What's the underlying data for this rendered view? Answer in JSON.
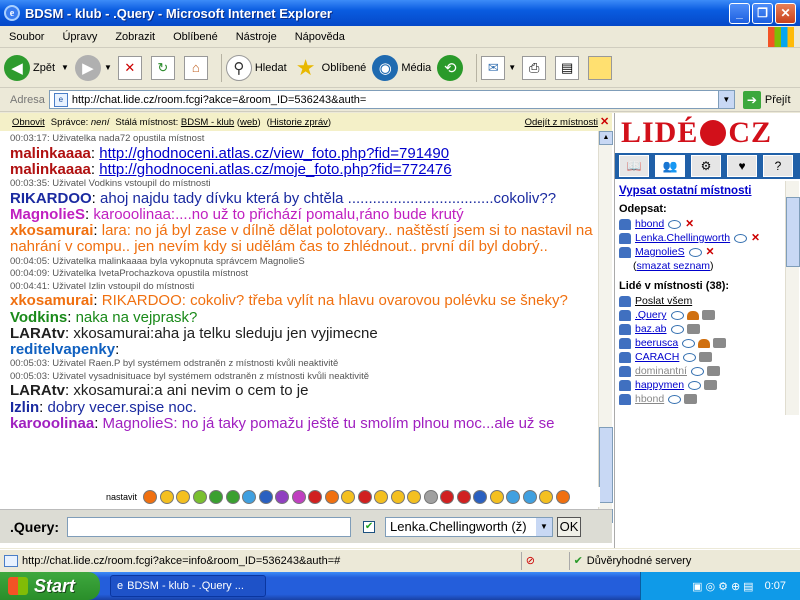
{
  "window": {
    "title": "BDSM - klub - .Query - Microsoft Internet Explorer"
  },
  "menu": [
    "Soubor",
    "Úpravy",
    "Zobrazit",
    "Oblíbené",
    "Nástroje",
    "Nápověda"
  ],
  "toolbar": {
    "back": "Zpět",
    "search": "Hledat",
    "favorites": "Oblíbené",
    "media": "Média"
  },
  "address": {
    "label": "Adresa",
    "url": "http://chat.lide.cz/room.fcgi?akce=&room_ID=536243&auth=",
    "go": "Přejít"
  },
  "topbar": {
    "refresh": "Obnovit",
    "admin_label": "Správce:",
    "admin_value": "není",
    "room_label": "Stálá místnost:",
    "room_name": "BDSM - klub",
    "web": "web",
    "history": "Historie zpráv",
    "leave": "Odejít z místnosti"
  },
  "messages": [
    {
      "type": "sys",
      "text": "00:03:17: Uživatelka nada72 opustila místnost"
    },
    {
      "type": "msg",
      "nick": "malinkaaaa",
      "nick_color": "#b01010",
      "link": "http://ghodnoceni.atlas.cz/view_foto.php?fid=791490"
    },
    {
      "type": "msg",
      "nick": "malinkaaaa",
      "nick_color": "#b01010",
      "link": "http://ghodnoceni.atlas.cz/moje_foto.php?fid=772476"
    },
    {
      "type": "sys",
      "text": "00:03:35: Uživatel Vodkins vstoupil do místnosti"
    },
    {
      "type": "msg",
      "nick": "RIKARDOO",
      "nick_color": "#1a2aa0",
      "text": "ahoj najdu tady dívku která by chtěla ...................................cokoliv??",
      "color": "#1a2aa0"
    },
    {
      "type": "msg",
      "nick": "MagnolieS",
      "nick_color": "#c020c0",
      "text": "karooolinaa:....no už to přichází pomalu,ráno bude krutý",
      "color": "#c020c0"
    },
    {
      "type": "msg",
      "nick": "xkosamurai",
      "nick_color": "#f07010",
      "text": "lara: no já byl zase v dílně dělat polotovary.. naštěstí jsem si to nastavil na nahrání v compu.. jen nevím kdy si udělám čas to zhlédnout.. první díl byl dobrý..",
      "color": "#f07010",
      "wrap": true
    },
    {
      "type": "sys",
      "text": "00:04:05: Uživatelka malinkaaaa byla vykopnuta správcem MagnolieS"
    },
    {
      "type": "sys",
      "text": "00:04:09: Uživatelka IvetaProchazkova opustila místnost"
    },
    {
      "type": "sys",
      "text": "00:04:41: Uživatel Izlin vstoupil do místnosti"
    },
    {
      "type": "msg",
      "nick": "xkosamurai",
      "nick_color": "#f07010",
      "text": "RIKARDOO: cokoliv? třeba vylít na hlavu ovarovou polévku se šneky?",
      "color": "#f07010"
    },
    {
      "type": "msg",
      "nick": "Vodkins",
      "nick_color": "#1a8a1a",
      "text": "naka na vejprask?",
      "color": "#1a8a1a"
    },
    {
      "type": "msg",
      "nick": "LARAtv",
      "nick_color": "#202020",
      "text": "xkosamurai:aha ja telku sleduju jen vyjimecne",
      "color": "#202020"
    },
    {
      "type": "msg",
      "nick": "reditelvapenky",
      "nick_color": "#1060c0",
      "text": "",
      "color": "#1060c0"
    },
    {
      "type": "sys",
      "text": "00:05:03: Uživatel Raen.P byl systémem odstraněn z místnosti kvůli neaktivitě"
    },
    {
      "type": "sys",
      "text": "00:05:03: Uživatel vysadnisituace byl systémem odstraněn z místnosti kvůli neaktivitě"
    },
    {
      "type": "msg",
      "nick": "LARAtv",
      "nick_color": "#202020",
      "text": "xkosamurai:a ani nevim o cem to je",
      "color": "#202020"
    },
    {
      "type": "msg",
      "nick": "Izlin",
      "nick_color": "#1a2aa0",
      "text": "dobry vecer.spise noc.",
      "color": "#1a2aa0"
    },
    {
      "type": "msg",
      "nick": "karooolinaa",
      "nick_color": "#a020c0",
      "text": "MagnolieS: no já taky pomažu ještě tu smolím plnou moc...ale už se",
      "color": "#a020c0"
    }
  ],
  "emobar": {
    "label": "nastavit"
  },
  "input": {
    "me": ".Query:",
    "value": "",
    "recipient": "Lenka.Chellingworth (ž)",
    "ok": "OK"
  },
  "side": {
    "logo_left": "LIDÉ",
    "logo_right": "CZ",
    "list_rooms": "Vypsat ostatní místnosti",
    "unsub_title": "Odepsat:",
    "unsub_users": [
      "hbond",
      "Lenka.Chellingworth",
      "MagnolieS"
    ],
    "clear": "smazat seznam",
    "people_title": "Lidé v místnosti (38):",
    "send_all": "Poslat všem",
    "people": [
      {
        "name": ".Query",
        "grey": false
      },
      {
        "name": "baz.ab",
        "grey": false
      },
      {
        "name": "beerusca",
        "grey": false
      },
      {
        "name": "CARACH",
        "grey": false
      },
      {
        "name": "dominantní",
        "grey": true
      },
      {
        "name": "happymen",
        "grey": false
      },
      {
        "name": "hbond",
        "grey": true
      }
    ]
  },
  "statusbar": {
    "url": "http://chat.lide.cz/room.fcgi?akce=info&room_ID=536243&auth=#",
    "zone": "Důvěryhodné servery"
  },
  "taskbar": {
    "start": "Start",
    "task": "BDSM - klub - .Query ...",
    "clock": "0:07"
  }
}
